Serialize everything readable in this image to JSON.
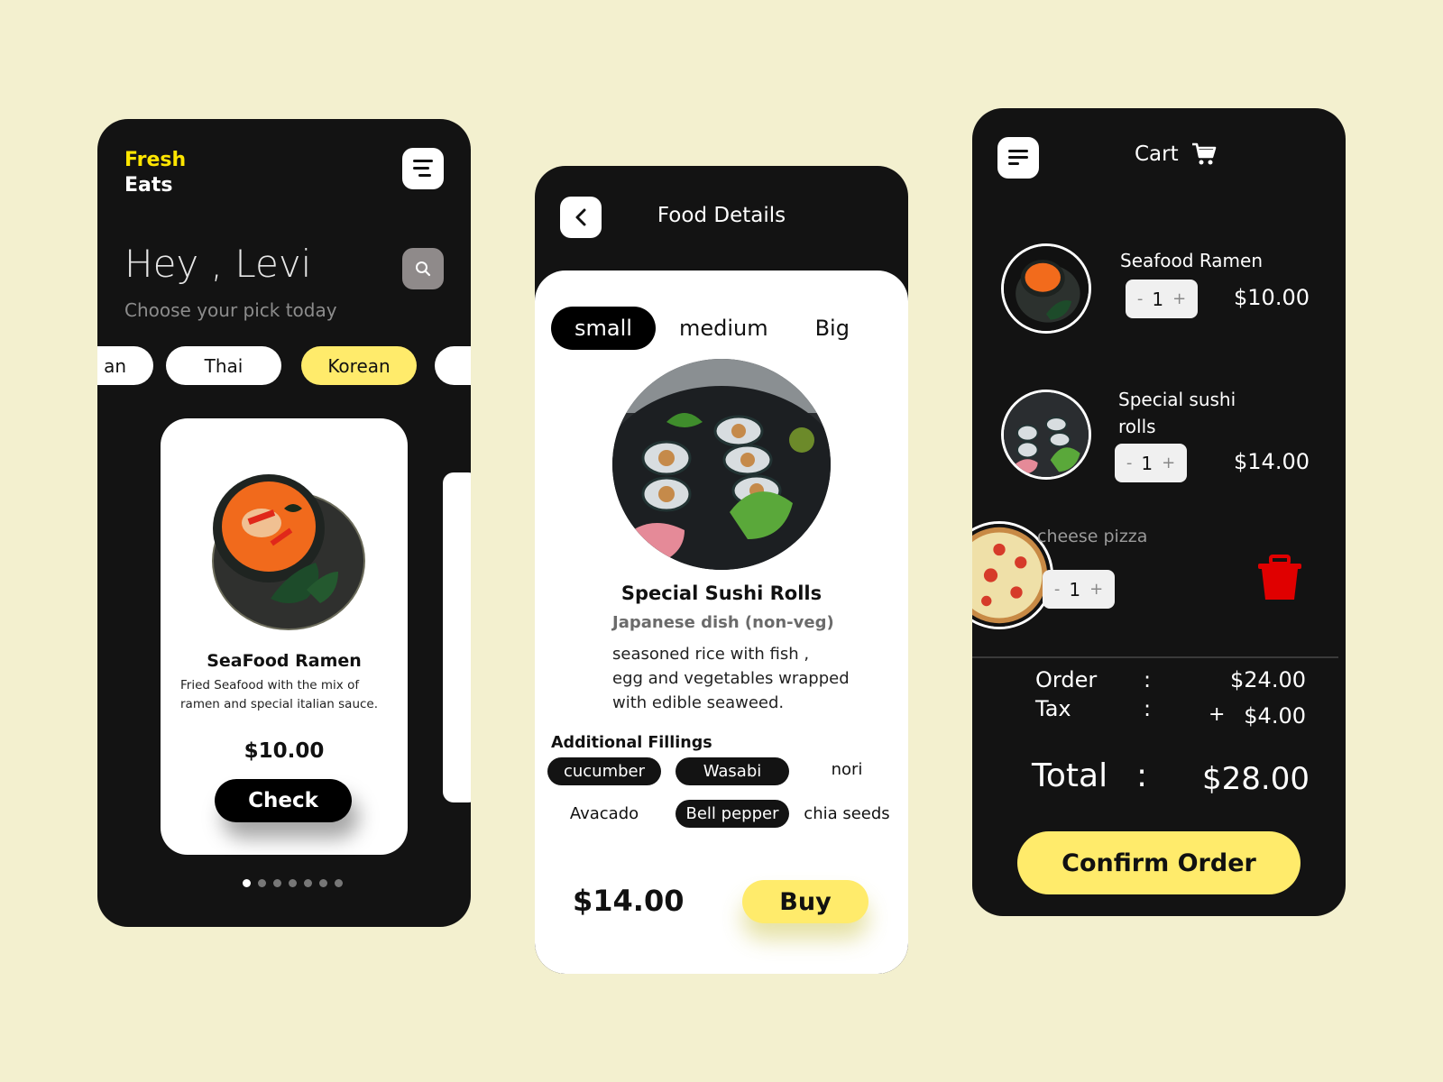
{
  "home": {
    "brand_line1": "Fresh",
    "brand_line2": "Eats",
    "greeting": "Hey , Levi",
    "subtitle": "Choose your pick today",
    "categories": [
      {
        "label": "an",
        "active": false
      },
      {
        "label": "Thai",
        "active": false
      },
      {
        "label": "Korean",
        "active": true
      },
      {
        "label": "",
        "active": false
      }
    ],
    "featured": {
      "title": "SeaFood Ramen",
      "description": "Fried Seafood with the mix of ramen and special italian sauce.",
      "price": "$10.00",
      "button": "Check"
    },
    "carousel": {
      "total": 7,
      "active_index": 0
    }
  },
  "details": {
    "title": "Food Details",
    "sizes": [
      {
        "label": "small",
        "active": true
      },
      {
        "label": "medium",
        "active": false
      },
      {
        "label": "Big",
        "active": false
      }
    ],
    "dish_name": "Special Sushi Rolls",
    "dish_type": "Japanese dish  (non-veg)",
    "description": "seasoned rice with fish ,\negg and vegetables wrapped\n with edible seaweed.",
    "fillings_title": "Additional Fillings",
    "fillings": [
      {
        "label": "cucumber",
        "selected": true
      },
      {
        "label": "Wasabi",
        "selected": true
      },
      {
        "label": "nori",
        "selected": false
      },
      {
        "label": "Avacado",
        "selected": false
      },
      {
        "label": "Bell pepper",
        "selected": true
      },
      {
        "label": "chia seeds",
        "selected": false
      }
    ],
    "price": "$14.00",
    "buy_label": "Buy"
  },
  "cart": {
    "title": "Cart",
    "items": [
      {
        "name": "Seafood Ramen",
        "qty": "1",
        "price": "$10.00"
      },
      {
        "name": "Special sushi rolls",
        "qty": "1",
        "price": "$14.00"
      },
      {
        "name": "cheese pizza",
        "qty": "1",
        "price": ""
      }
    ],
    "stepper": {
      "minus": "-",
      "plus": "+"
    },
    "summary": {
      "order_label": "Order",
      "order_value": "$24.00",
      "tax_label": "Tax",
      "tax_sign": "+",
      "tax_value": "$4.00",
      "colon": ":",
      "total_label": "Total",
      "total_value": "$28.00"
    },
    "confirm_label": "Confirm Order"
  },
  "colors": {
    "background": "#f3f0cf",
    "panel": "#131313",
    "accent_yellow": "#ffeb6b",
    "brand_yellow": "#ffe600",
    "delete_red": "#e00000"
  }
}
